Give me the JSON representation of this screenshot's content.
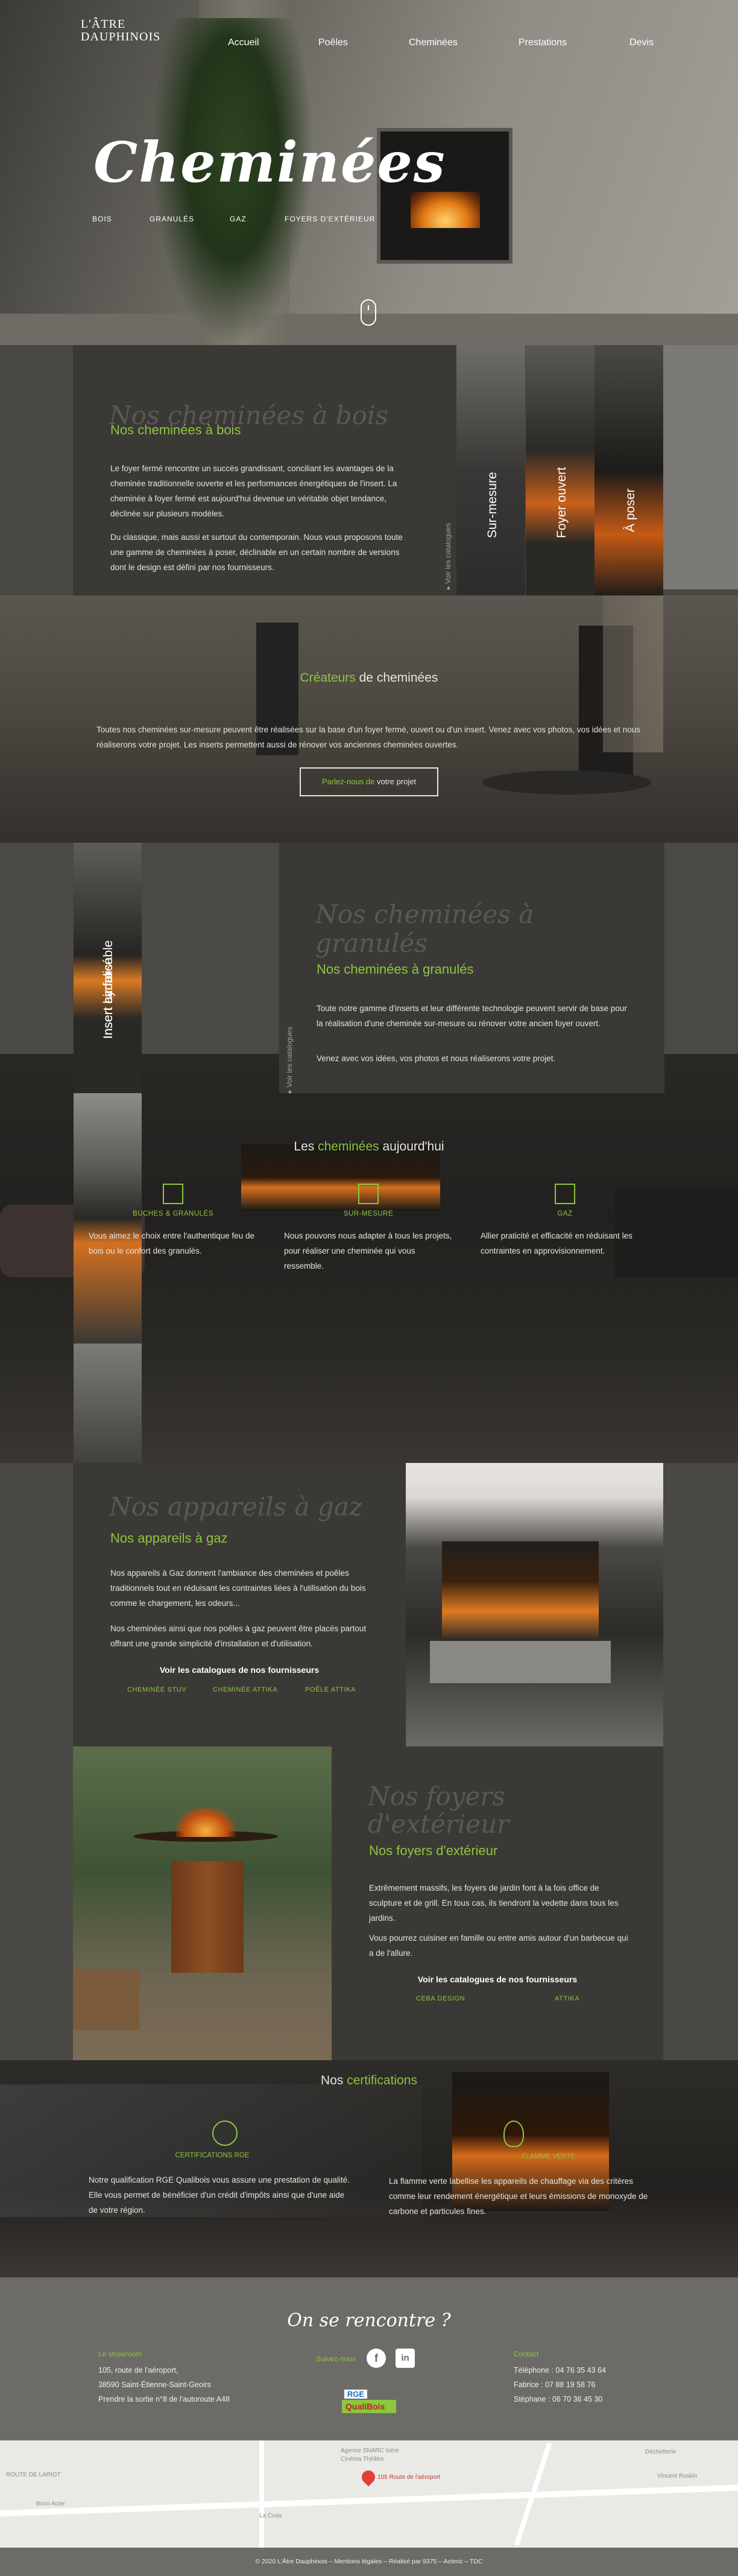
{
  "header": {
    "logo_line1": "L'ÂTRE",
    "logo_line2": "DAUPHINOIS",
    "nav": [
      "Accueil",
      "Poêles",
      "Cheminées",
      "Prestations",
      "Devis"
    ]
  },
  "hero": {
    "title": "Cheminées",
    "subnav": [
      "BOIS",
      "GRANULÉS",
      "GAZ",
      "FOYERS D'EXTÉRIEUR"
    ]
  },
  "bois": {
    "script_title": "Nos cheminées à bois",
    "title": "Nos cheminées à bois",
    "p1": "Le foyer fermé rencontre un succès grandissant, conciliant les avantages de la cheminée traditionnelle ouverte et les performances énergétiques de l'insert. La cheminée à foyer fermé est aujourd'hui devenue un véritable objet tendance, déclinée sur plusieurs modèles.",
    "p2": "Du classique, mais aussi et surtout du contemporain. Nous vous proposons toute une gamme de cheminées à poser, déclinable en un certain nombre de versions dont le design est défini par nos fournisseurs.",
    "catalog_link": "Voir les catalogues",
    "strips": [
      "Sur-mesure",
      "Foyer ouvert",
      "À poser"
    ]
  },
  "createurs": {
    "title_green": "Créateurs",
    "title_rest": " de cheminées",
    "text": "Toutes nos cheminées sur-mesure peuvent être réalisées sur la base d'un foyer fermé, ouvert ou d'un insert. Venez avec vos photos, vos idées et nous réaliserons votre projet. Les inserts permettent aussi de rénover vos anciennes cheminées ouvertes.",
    "button_green": "Parlez-nous de",
    "button_rest": " votre projet"
  },
  "granules": {
    "script_title": "Nos cheminées à granulés",
    "title": "Nos cheminées à granulés",
    "p1": "Toute notre gamme d'inserts et leur différente technologie peuvent servir de base pour la réalisation d'une cheminée sur-mesure ou rénover votre ancien foyer ouvert.",
    "p2": "Venez avec vos idées, vos photos et nous réaliserons votre projet.",
    "catalog_link": "Voir les catalogues",
    "strips": [
      "Insert air forcé",
      "Insert hydro",
      "Insert canalisable"
    ]
  },
  "today": {
    "title_pre": "Les ",
    "title_green": "cheminées",
    "title_post": " aujourd'hui",
    "features": [
      {
        "label": "BUCHES & GRANULÉS",
        "text": "Vous aimez le choix entre l'authentique feu de bois ou le confort des granulés."
      },
      {
        "label": "SUR-MESURE",
        "text": "Nous pouvons nous adapter à tous les projets, pour réaliser une cheminée qui vous ressemble."
      },
      {
        "label": "GAZ",
        "text": "Allier praticité et efficacité en réduisant les contraintes en approvisionnement."
      }
    ]
  },
  "gaz": {
    "script_title": "Nos appareils à gaz",
    "title": "Nos appareils à gaz",
    "p1": "Nos appareils à Gaz donnent l'ambiance des cheminées et poêles traditionnels tout en réduisant les contraintes liées à l'utilisation du bois comme le chargement, les odeurs...",
    "p2": "Nos cheminées ainsi que nos poêles à gaz peuvent être placés partout offrant une grande simplicité d'installation et d'utilisation.",
    "catalogs_title": "Voir les catalogues de nos fournisseurs",
    "links": [
      "CHEMINÉE STUV",
      "CHEMINÉE ATTIKA",
      "POÊLE ATTIKA"
    ]
  },
  "exterieur": {
    "script_title": "Nos foyers d'extérieur",
    "title": "Nos foyers d'extérieur",
    "p1": "Extrêmement massifs, les foyers de jardin font à la fois office de sculpture et de grill. En tous cas, ils tiendront la vedette dans tous les jardins.",
    "p2": "Vous pourrez cuisiner en famille ou entre amis autour d'un barbecue qui a de l'allure.",
    "catalogs_title": "Voir les catalogues de nos fournisseurs",
    "links": [
      "CEBA DESIGN",
      "ATTIKA"
    ]
  },
  "certif": {
    "title_pre": "Nos ",
    "title_green": "certifications",
    "items": [
      {
        "label": "CERTIFICATIONS RGE",
        "text": "Notre qualification RGE Qualibois vous assure une prestation de qualité. Elle vous permet de bénéficier d'un crédit d'impôts ainsi que d'une aide de votre région."
      },
      {
        "label": "FLAMME VERTE",
        "text": "La flamme verte labellise les appareils de chauffage via des critères comme leur rendement énergétique et leurs émissions de monoxyde de carbone et particules fines."
      }
    ]
  },
  "contact": {
    "script_title": "On se rencontre ?",
    "showroom_title": "Le showroom",
    "address": [
      "105, route de l'aéroport,",
      "38590 Saint-Étienne-Saint-Geoirs",
      "Prendre la sortie n°8 de l'autoroute A48"
    ],
    "follow_title": "Suivez-nous",
    "contact_title": "Contact",
    "phones": [
      "Téléphone : 04 76 35 43 64",
      "Fabrice : 07 88 19 58 76",
      "Stéphane : 06 70 36 45 30"
    ],
    "rge_label": "RGE",
    "qualibois_label": "QualiBois"
  },
  "map": {
    "labels": [
      "Agence SNARC Isère",
      "Cinéma Théâtre",
      "ROUTE DE LARIOT",
      "Brico Acier",
      "La Croix",
      "105 Route de l'aéroport",
      "Déchetterie",
      "Vincent Ruskin"
    ]
  },
  "footer": {
    "text": "© 2020 L'Âtre Dauphinois – Mentions légales – Réalisé par 9375 – Acteric – TDC"
  },
  "colors": {
    "accent": "#8dc63f",
    "card": "#3b3936",
    "bg": "#4a4844"
  }
}
